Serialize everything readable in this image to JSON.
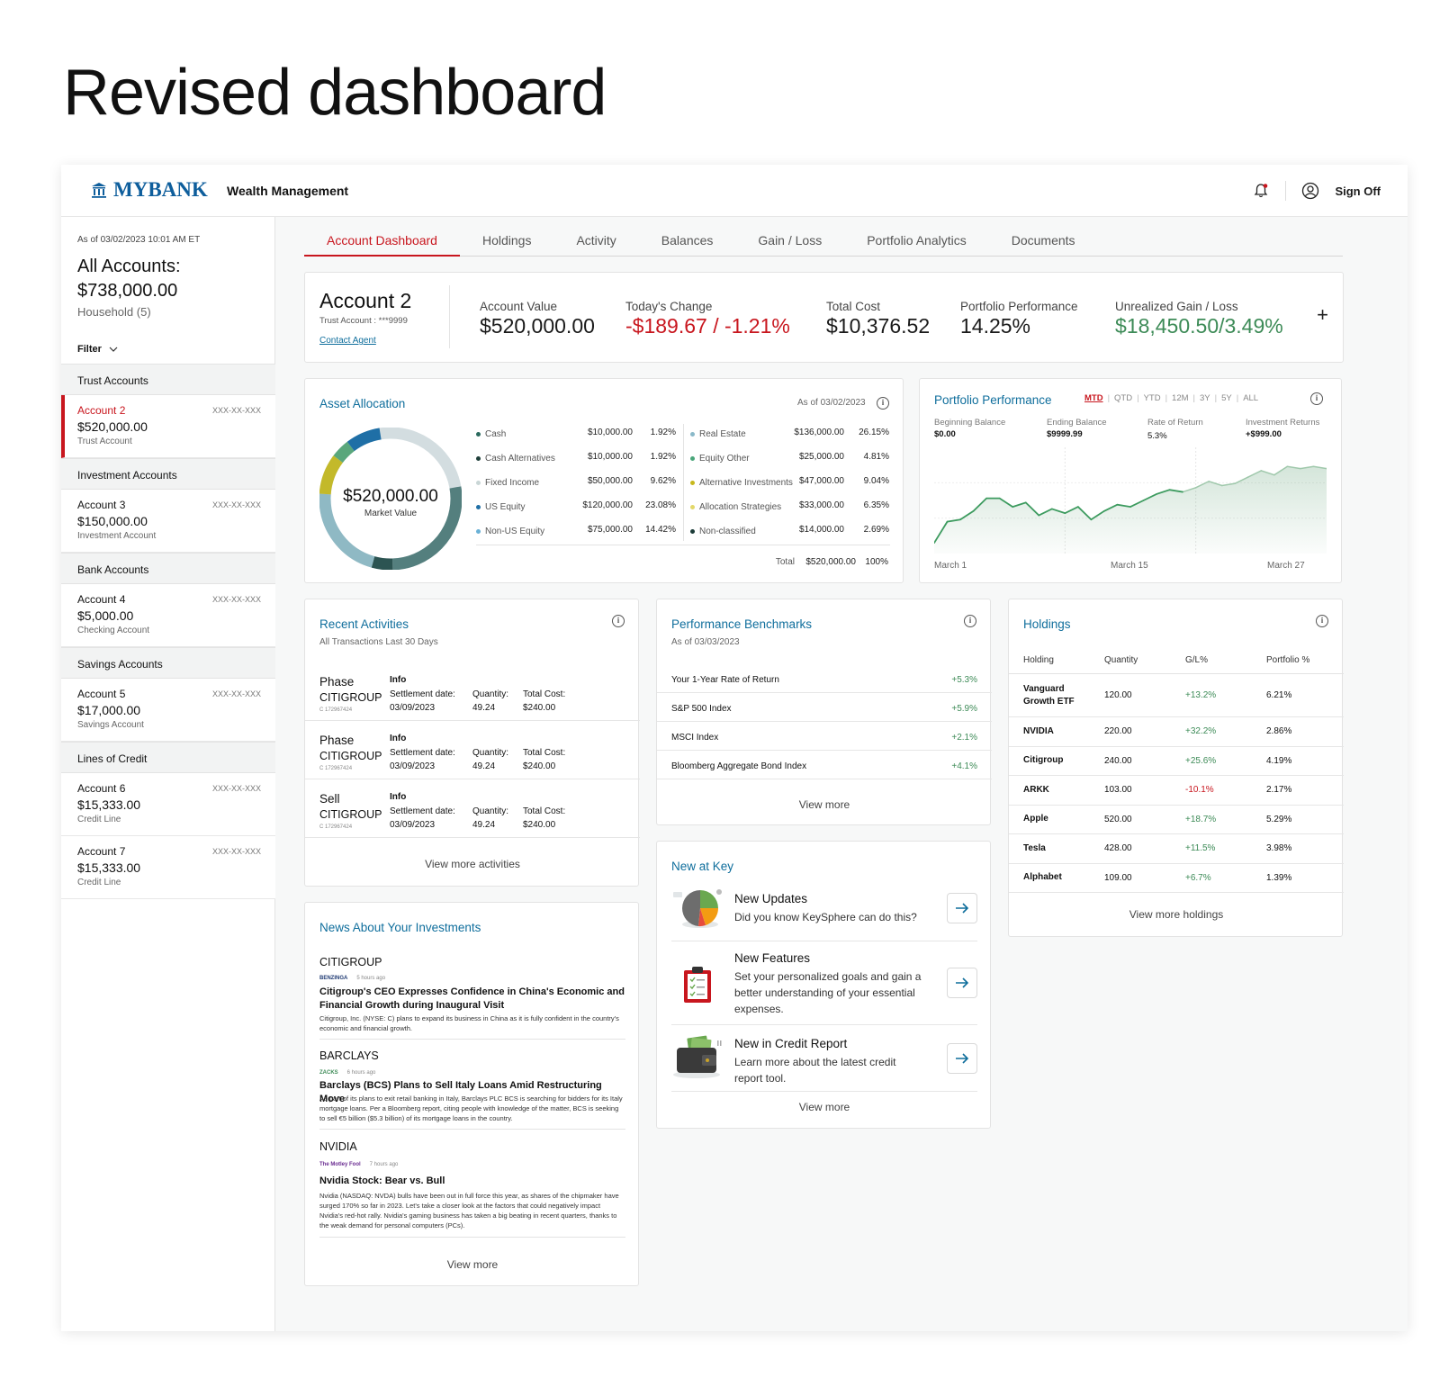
{
  "page_heading": "Revised dashboard",
  "header": {
    "brand": "MYBANK",
    "subtitle": "Wealth Management",
    "sign_off": "Sign Off"
  },
  "sidebar": {
    "as_of": "As of 03/02/2023 10:01 AM ET",
    "all_accounts_label": "All Accounts:",
    "all_accounts_value": "$738,000.00",
    "household": "Household (5)",
    "filter": "Filter",
    "groups": [
      {
        "label": "Trust Accounts",
        "accounts": [
          {
            "name": "Account 2",
            "amount": "$520,000.00",
            "type": "Trust Account",
            "mask": "XXX-XX-XXX"
          }
        ]
      },
      {
        "label": "Investment Accounts",
        "accounts": [
          {
            "name": "Account 3",
            "amount": "$150,000.00",
            "type": "Investment Account",
            "mask": "XXX-XX-XXX"
          }
        ]
      },
      {
        "label": "Bank Accounts",
        "accounts": [
          {
            "name": "Account 4",
            "amount": "$5,000.00",
            "type": "Checking Account",
            "mask": "XXX-XX-XXX"
          }
        ]
      },
      {
        "label": "Savings Accounts",
        "accounts": [
          {
            "name": "Account 5",
            "amount": "$17,000.00",
            "type": "Savings Account",
            "mask": "XXX-XX-XXX"
          }
        ]
      },
      {
        "label": "Lines of Credit",
        "accounts": [
          {
            "name": "Account 6",
            "amount": "$15,333.00",
            "type": "Credit Line",
            "mask": "XXX-XX-XXX"
          },
          {
            "name": "Account 7",
            "amount": "$15,333.00",
            "type": "Credit Line",
            "mask": "XXX-XX-XXX"
          }
        ]
      }
    ]
  },
  "tabs": [
    "Account Dashboard",
    "Holdings",
    "Activity",
    "Balances",
    "Gain / Loss",
    "Portfolio Analytics",
    "Documents"
  ],
  "account": {
    "name": "Account 2",
    "subtitle": "Trust Account : ***9999",
    "contact": "Contact Agent",
    "metrics": [
      {
        "label": "Account Value",
        "value": "$520,000.00"
      },
      {
        "label": "Today's Change",
        "value": "-$189.67 / -1.21%"
      },
      {
        "label": "Total Cost",
        "value": "$10,376.52"
      },
      {
        "label": "Portfolio Performance",
        "value": "14.25%"
      },
      {
        "label": "Unrealized Gain / Loss",
        "value": "$18,450.50/3.49%"
      }
    ],
    "plus": "+"
  },
  "allocation": {
    "title": "Asset Allocation",
    "as_of": "As of 03/02/2023",
    "center_value": "$520,000.00",
    "center_label": "Market Value",
    "left": [
      {
        "label": "Cash",
        "value": "$10,000.00",
        "pct": "1.92%",
        "color": "#2a6a5e"
      },
      {
        "label": "Cash Alternatives",
        "value": "$10,000.00",
        "pct": "1.92%",
        "color": "#1f3f3a"
      },
      {
        "label": "Fixed Income",
        "value": "$50,000.00",
        "pct": "9.62%",
        "color": "#c9d6d6"
      },
      {
        "label": "US Equity",
        "value": "$120,000.00",
        "pct": "23.08%",
        "color": "#1f6fa6"
      },
      {
        "label": "Non-US Equity",
        "value": "$75,000.00",
        "pct": "14.42%",
        "color": "#6ab1d6"
      }
    ],
    "right": [
      {
        "label": "Real Estate",
        "value": "$136,000.00",
        "pct": "26.15%",
        "color": "#8ab9c9"
      },
      {
        "label": "Equity Other",
        "value": "$25,000.00",
        "pct": "4.81%",
        "color": "#4aa67a"
      },
      {
        "label": "Alternative Investments",
        "value": "$47,000.00",
        "pct": "9.04%",
        "color": "#c7b81c"
      },
      {
        "label": "Allocation Strategies",
        "value": "$33,000.00",
        "pct": "6.35%",
        "color": "#e3d86a"
      },
      {
        "label": "Non-classified",
        "value": "$14,000.00",
        "pct": "2.69%",
        "color": "#1b3b38"
      }
    ],
    "total_label": "Total",
    "total_value": "$520,000.00",
    "total_pct": "100%"
  },
  "performance": {
    "title": "Portfolio Performance",
    "periods": [
      "MTD",
      "QTD",
      "YTD",
      "12M",
      "3Y",
      "5Y",
      "ALL"
    ],
    "active_period": "MTD",
    "stats": [
      {
        "label": "Beginning Balance",
        "value": "$0.00"
      },
      {
        "label": "Ending Balance",
        "value": "$9999.99"
      },
      {
        "label": "Rate of Return",
        "value": "5.3%"
      },
      {
        "label": "Investment Returns",
        "value": "+$999.00"
      }
    ],
    "x_labels": [
      "March 1",
      "March 15",
      "March 27"
    ],
    "chart_data": {
      "type": "area",
      "x": [
        1,
        2,
        3,
        4,
        5,
        6,
        7,
        8,
        9,
        10,
        11,
        12,
        13,
        14,
        15,
        16,
        17,
        18,
        19,
        20,
        21,
        22,
        23,
        24,
        25,
        26,
        27,
        28,
        29,
        30,
        31
      ],
      "values": [
        10,
        30,
        32,
        40,
        52,
        52,
        44,
        48,
        36,
        42,
        38,
        44,
        32,
        40,
        46,
        44,
        50,
        56,
        60,
        58,
        62,
        68,
        64,
        66,
        72,
        78,
        74,
        82,
        80,
        82,
        80
      ],
      "xticklabels": [
        "March 1",
        "March 15",
        "March 27"
      ]
    }
  },
  "activities": {
    "title": "Recent Activities",
    "subtitle": "All Transactions Last 30 Days",
    "info_label": "Info",
    "settle_label": "Settlement date:",
    "qty_label": "Quantity:",
    "cost_label": "Total Cost:",
    "rows": [
      {
        "type": "Phase",
        "symbol": "CITIGROUP",
        "id": "C 172967424",
        "date": "03/09/2023",
        "qty": "49.24",
        "cost": "$240.00"
      },
      {
        "type": "Phase",
        "symbol": "CITIGROUP",
        "id": "C 172967424",
        "date": "03/09/2023",
        "qty": "49.24",
        "cost": "$240.00"
      },
      {
        "type": "Sell",
        "symbol": "CITIGROUP",
        "id": "C 172967424",
        "date": "03/09/2023",
        "qty": "49.24",
        "cost": "$240.00"
      }
    ],
    "view_more": "View more activities"
  },
  "benchmarks": {
    "title": "Performance Benchmarks",
    "as_of": "As of 03/03/2023",
    "rows": [
      {
        "label": "Your 1-Year Rate of Return",
        "value": "+5.3%"
      },
      {
        "label": "S&P 500 Index",
        "value": "+5.9%"
      },
      {
        "label": "MSCI Index",
        "value": "+2.1%"
      },
      {
        "label": "Bloomberg Aggregate Bond Index",
        "value": "+4.1%"
      }
    ],
    "view_more": "View more"
  },
  "holdings": {
    "title": "Holdings",
    "columns": [
      "Holding",
      "Quantity",
      "G/L%",
      "Portfolio %"
    ],
    "rows": [
      {
        "name": "Vanguard Growth ETF",
        "qty": "120.00",
        "gl": "+13.2%",
        "pct": "6.21%",
        "neg": false
      },
      {
        "name": "NVIDIA",
        "qty": "220.00",
        "gl": "+32.2%",
        "pct": "2.86%",
        "neg": false
      },
      {
        "name": "Citigroup",
        "qty": "240.00",
        "gl": "+25.6%",
        "pct": "4.19%",
        "neg": false
      },
      {
        "name": "ARKK",
        "qty": "103.00",
        "gl": "-10.1%",
        "pct": "2.17%",
        "neg": true
      },
      {
        "name": "Apple",
        "qty": "520.00",
        "gl": "+18.7%",
        "pct": "5.29%",
        "neg": false
      },
      {
        "name": "Tesla",
        "qty": "428.00",
        "gl": "+11.5%",
        "pct": "3.98%",
        "neg": false
      },
      {
        "name": "Alphabet",
        "qty": "109.00",
        "gl": "+6.7%",
        "pct": "1.39%",
        "neg": false
      }
    ],
    "view_more": "View more holdings"
  },
  "new_at_key": {
    "title": "New at Key",
    "items": [
      {
        "title": "New Updates",
        "desc": "Did you know KeySphere can do this?"
      },
      {
        "title": "New Features",
        "desc": "Set your personalized goals and gain a better understanding of your essential expenses."
      },
      {
        "title": "New in Credit Report",
        "desc": "Learn more about the latest credit report tool."
      }
    ],
    "view_more": "View more"
  },
  "news": {
    "title": "News About Your Investments",
    "items": [
      {
        "company": "CITIGROUP",
        "source": "BENZINGA",
        "time": "5 hours ago",
        "headline": "Citigroup's CEO Expresses Confidence in China's Economic and Financial Growth during Inaugural Visit",
        "body": "Citigroup, Inc. (NYSE: C) plans to expand its business in China as it is fully confident in the country's economic and financial growth."
      },
      {
        "company": "BARCLAYS",
        "source": "ZACKS",
        "time": "6 hours ago",
        "headline": "Barclays (BCS) Plans to Sell Italy Loans Amid Restructuring Move",
        "body": "As part of its plans to exit retail banking in Italy, Barclays PLC BCS is searching for bidders for its Italy mortgage loans. Per a Bloomberg report, citing people with knowledge of the matter, BCS is seeking to sell €5 billion ($5.3 billion) of its mortgage loans in the country."
      },
      {
        "company": "NVIDIA",
        "source": "The Motley Fool",
        "time": "7 hours ago",
        "headline": "Nvidia Stock: Bear vs. Bull",
        "body": "Nvidia (NASDAQ: NVDA) bulls have been out in full force this year, as shares of the chipmaker have surged 170% so far in 2023. Let's take a closer look at the factors that could negatively impact Nvidia's red-hot rally. Nvidia's gaming business has taken a big beating in recent quarters, thanks to the weak demand for personal computers (PCs)."
      }
    ],
    "view_more": "View more"
  }
}
